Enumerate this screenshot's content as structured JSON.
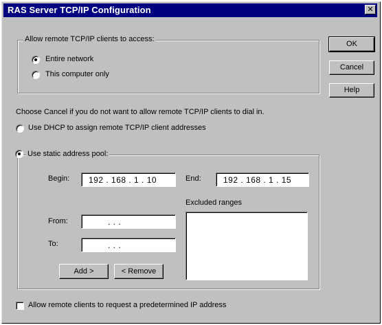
{
  "window": {
    "title": "RAS Server TCP/IP Configuration",
    "close_glyph": "✕"
  },
  "access_group": {
    "legend": "Allow remote TCP/IP clients to access:",
    "options": [
      {
        "label": "Entire network",
        "accel": "n",
        "selected": true
      },
      {
        "label": "This computer only",
        "accel": "c",
        "selected": false
      }
    ]
  },
  "buttons": {
    "ok": "OK",
    "cancel": "Cancel",
    "help": "Help"
  },
  "instruction": "Choose Cancel if you do not want to allow remote TCP/IP clients to dial in.",
  "dhcp_option": {
    "label": "Use DHCP to assign remote TCP/IP client addresses",
    "selected": false
  },
  "static_pool": {
    "label": "Use static address pool:",
    "selected": true,
    "begin_label": "Begin:",
    "begin_value": "192 . 168 .  1  . 10",
    "end_label": "End:",
    "end_value": "192 . 168 .  1  . 15",
    "excluded_label": "Excluded ranges",
    "from_label": "From:",
    "from_value": ".      .      .",
    "to_label": "To:",
    "to_value": ".      .      .",
    "add_button": "Add >",
    "remove_button": "< Remove"
  },
  "predetermined_checkbox": {
    "label": "Allow remote clients to request a predetermined IP address",
    "checked": false
  }
}
